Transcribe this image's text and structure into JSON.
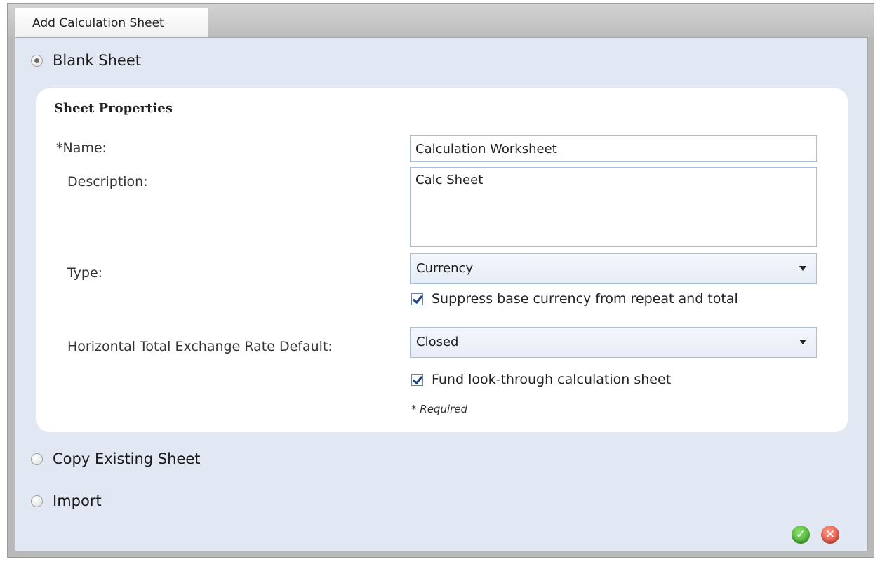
{
  "dialog": {
    "title": "Add Calculation Sheet",
    "options": {
      "blank": "Blank Sheet",
      "copy": "Copy Existing Sheet",
      "import": "Import"
    },
    "selected_option": "blank"
  },
  "sheet_properties": {
    "title": "Sheet Properties",
    "name_label": "*Name:",
    "name_value": "Calculation Worksheet",
    "description_label": "Description:",
    "description_value": "Calc Sheet",
    "type_label": "Type:",
    "type_value": "Currency",
    "suppress_label": "Suppress base currency from repeat and total",
    "suppress_checked": true,
    "exchange_label": "Horizontal Total Exchange Rate Default:",
    "exchange_value": "Closed",
    "fund_label": "Fund look-through calculation sheet",
    "fund_checked": true,
    "required_note": "* Required"
  },
  "actions": {
    "ok_icon": "check-circle-icon",
    "cancel_icon": "x-circle-icon",
    "ok_color": "#2f9e1e",
    "cancel_color": "#d8392a"
  },
  "colors": {
    "body_bg": "#e1e8f4",
    "panel_bg": "#ffffff",
    "field_border": "#a9bedb"
  }
}
